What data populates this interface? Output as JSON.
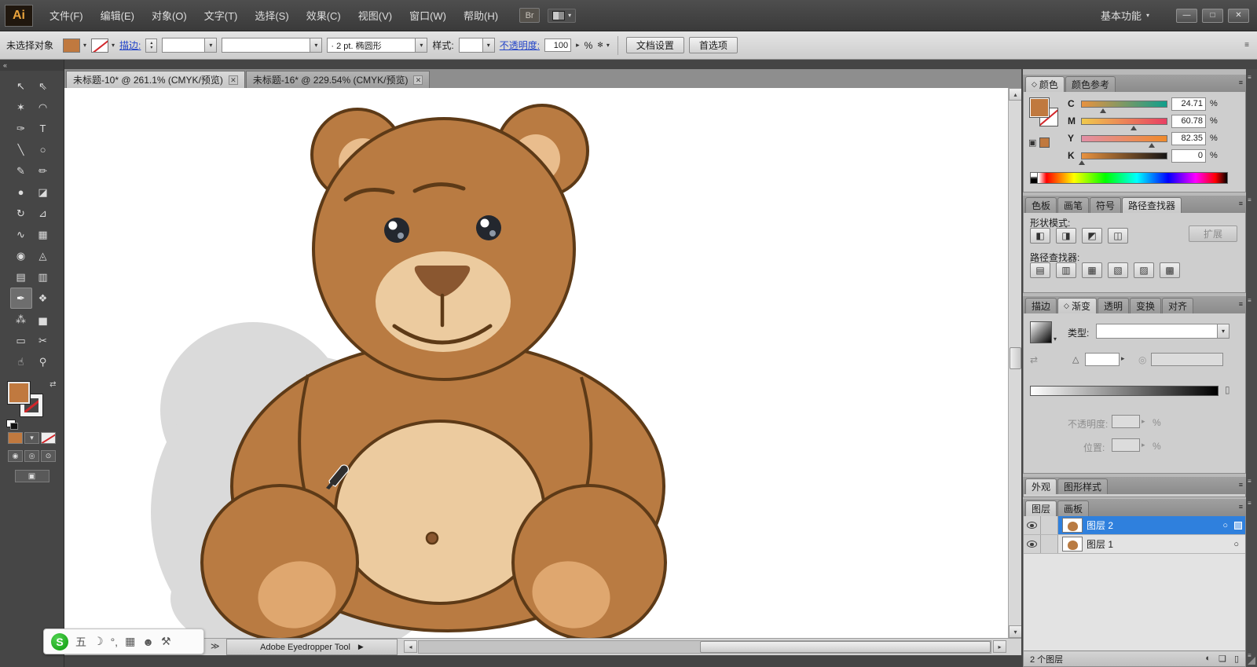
{
  "titlebar": {
    "logo": "Ai",
    "menus": [
      "文件(F)",
      "编辑(E)",
      "对象(O)",
      "文字(T)",
      "选择(S)",
      "效果(C)",
      "视图(V)",
      "窗口(W)",
      "帮助(H)"
    ],
    "bridge": "Br",
    "workspace": "基本功能"
  },
  "controlbar": {
    "selection_status": "未选择对象",
    "stroke_label": "描边:",
    "brush_prefix": "·",
    "brush_def": "2 pt. 椭圆形",
    "style_label": "样式:",
    "opacity_label": "不透明度:",
    "opacity_value": "100",
    "unit_percent": "%",
    "doc_setup": "文档设置",
    "preferences": "首选项"
  },
  "doc_tabs": [
    {
      "title": "未标题-10* @ 261.1% (CMYK/预览)"
    },
    {
      "title": "未标题-16* @ 229.54% (CMYK/预览)"
    }
  ],
  "toolbar": {
    "tools": [
      {
        "name": "selection-tool",
        "glyph": "↖"
      },
      {
        "name": "direct-selection-tool",
        "glyph": "⇖"
      },
      {
        "name": "magic-wand-tool",
        "glyph": "✶"
      },
      {
        "name": "lasso-tool",
        "glyph": "◠"
      },
      {
        "name": "pen-tool",
        "glyph": "✑"
      },
      {
        "name": "type-tool",
        "glyph": "T"
      },
      {
        "name": "line-segment-tool",
        "glyph": "╲"
      },
      {
        "name": "ellipse-tool",
        "glyph": "○"
      },
      {
        "name": "paintbrush-tool",
        "glyph": "✎"
      },
      {
        "name": "pencil-tool",
        "glyph": "✏"
      },
      {
        "name": "blob-brush-tool",
        "glyph": "●"
      },
      {
        "name": "eraser-tool",
        "glyph": "◪"
      },
      {
        "name": "rotate-tool",
        "glyph": "↻"
      },
      {
        "name": "scale-tool",
        "glyph": "⊿"
      },
      {
        "name": "width-tool",
        "glyph": "∿"
      },
      {
        "name": "free-transform-tool",
        "glyph": "▦"
      },
      {
        "name": "shape-builder-tool",
        "glyph": "◉"
      },
      {
        "name": "perspective-grid-tool",
        "glyph": "◬"
      },
      {
        "name": "mesh-tool",
        "glyph": "▤"
      },
      {
        "name": "gradient-tool",
        "glyph": "▥"
      },
      {
        "name": "eyedropper-tool",
        "glyph": "✒"
      },
      {
        "name": "blend-tool",
        "glyph": "❖"
      },
      {
        "name": "symbol-sprayer-tool",
        "glyph": "⁂"
      },
      {
        "name": "graph-tool",
        "glyph": "▅"
      },
      {
        "name": "artboard-tool",
        "glyph": "▭"
      },
      {
        "name": "slice-tool",
        "glyph": "✂"
      },
      {
        "name": "hand-tool",
        "glyph": "☝"
      },
      {
        "name": "zoom-tool",
        "glyph": "⚲"
      }
    ]
  },
  "color_panel": {
    "tabs": [
      "颜色",
      "颜色参考"
    ],
    "channels": [
      {
        "label": "C",
        "value": "24.71",
        "percent": 24.71
      },
      {
        "label": "M",
        "value": "60.78",
        "percent": 60.78
      },
      {
        "label": "Y",
        "value": "82.35",
        "percent": 82.35
      },
      {
        "label": "K",
        "value": "0",
        "percent": 0
      }
    ],
    "unit": "%"
  },
  "swatches_tabs": [
    "色板",
    "画笔",
    "符号",
    "路径查找器"
  ],
  "pathfinder_panel": {
    "shape_modes_label": "形状模式:",
    "expand": "扩展",
    "pathfinder_label": "路径查找器:",
    "shape_modes": [
      {
        "name": "unite",
        "glyph": "◧"
      },
      {
        "name": "minus-front",
        "glyph": "◨"
      },
      {
        "name": "intersect",
        "glyph": "◩"
      },
      {
        "name": "exclude",
        "glyph": "◫"
      }
    ],
    "pathfinders": [
      {
        "name": "divide",
        "glyph": "▤"
      },
      {
        "name": "trim",
        "glyph": "▥"
      },
      {
        "name": "merge",
        "glyph": "▦"
      },
      {
        "name": "crop",
        "glyph": "▧"
      },
      {
        "name": "outline",
        "glyph": "▨"
      },
      {
        "name": "minus-back",
        "glyph": "▩"
      }
    ]
  },
  "gradient_panel": {
    "tabs": [
      "描边",
      "渐变",
      "透明",
      "变换",
      "对齐"
    ],
    "type_label": "类型:",
    "opacity_label": "不透明度:",
    "location_label": "位置:",
    "unit": "%"
  },
  "appearance_tabs": [
    "外观",
    "图形样式"
  ],
  "layers_panel": {
    "tabs": [
      "图层",
      "画板"
    ],
    "layers": [
      {
        "name": "图层 2",
        "selected": true
      },
      {
        "name": "图层 1",
        "selected": false
      }
    ],
    "count": "2 个图层"
  },
  "statusbar": {
    "tool": "Adobe Eyedropper Tool"
  },
  "ime": {
    "logo": "S",
    "items": [
      "五",
      "☽",
      "°,",
      "▦",
      "☻",
      "⚒"
    ]
  },
  "icons": {
    "dropdown": "▾",
    "stepper_right": "▸",
    "arrow_up": "▲",
    "arrow_down": "▼",
    "tri_up": "▴",
    "tri_down": "▾",
    "tri_left": "◂",
    "tri_right": "▸",
    "menu": "≡",
    "close": "✕",
    "minimize": "—",
    "restore": "□",
    "collapse": "«",
    "expand_right": "≫",
    "play": "▶",
    "diamond": "◇",
    "swap": "⇄",
    "target": "○",
    "angle": "△",
    "reverse": "⇄",
    "aspect": "◎",
    "delete_stop": "▯",
    "cube": "▣",
    "recolor": "✻",
    "clip_mask": "◐",
    "new_layer": "❏",
    "trash": "▯",
    "draw_normal": "◉",
    "draw_behind": "◎",
    "draw_inside": "⊙",
    "screen_mode": "▣"
  },
  "colors": {
    "fill_orange": "#c0793f",
    "selection_blue": "#2f80dd",
    "bear_main": "#b97b42",
    "bear_light": "#eccb9f",
    "bear_outline": "#5d3a17",
    "bear_nose": "#8a5730",
    "shadow_gray": "#dadada"
  }
}
